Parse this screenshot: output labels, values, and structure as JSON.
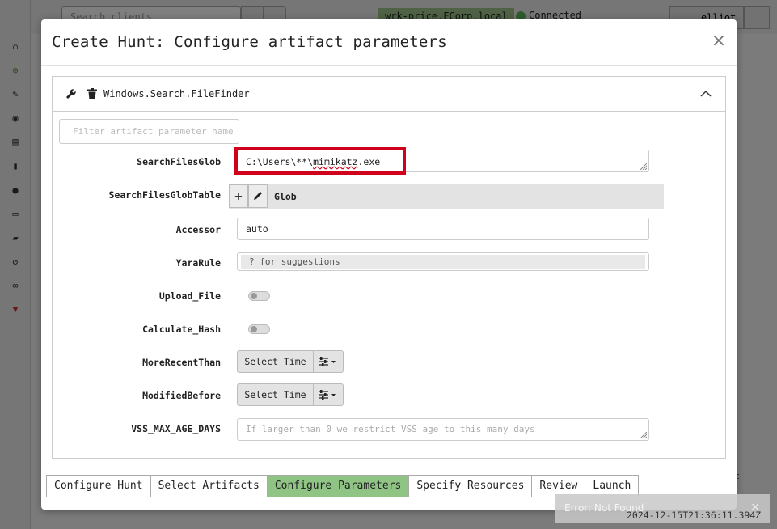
{
  "background": {
    "search_placeholder": "Search clients",
    "host": "wrk-price.FCorp.local",
    "connection_status": "Connected",
    "user": "elliot",
    "timestamp": "2024-12-15T21:36:11.394Z",
    "side_letter": "c"
  },
  "modal": {
    "title": "Create Hunt: Configure artifact parameters",
    "close_glyph": "×"
  },
  "artifact": {
    "name": "Windows.Search.FileFinder",
    "filter_placeholder": "Filter artifact parameter name"
  },
  "params": {
    "search_files_glob": {
      "label": "SearchFilesGlob",
      "value_prefix": "C:\\Users\\**\\",
      "value_word": "mimikatz",
      "value_suffix": ".exe"
    },
    "search_files_glob_table": {
      "label": "SearchFilesGlobTable",
      "column": "Glob"
    },
    "accessor": {
      "label": "Accessor",
      "value": "auto"
    },
    "yara_rule": {
      "label": "YaraRule",
      "placeholder": "? for suggestions"
    },
    "upload_file": {
      "label": "Upload_File",
      "enabled": false
    },
    "calculate_hash": {
      "label": "Calculate_Hash",
      "enabled": false
    },
    "more_recent_than": {
      "label": "MoreRecentThan",
      "button": "Select Time"
    },
    "modified_before": {
      "label": "ModifiedBefore",
      "button": "Select Time"
    },
    "vss_max_age_days": {
      "label": "VSS_MAX_AGE_DAYS",
      "placeholder": "If larger than 0 we restrict VSS age to this many days"
    }
  },
  "wizard": {
    "steps": [
      "Configure Hunt",
      "Select Artifacts",
      "Configure Parameters",
      "Specify Resources",
      "Review",
      "Launch"
    ],
    "active_index": 2
  },
  "toast": {
    "message": "Error: Not Found",
    "close_glyph": "×"
  },
  "colors": {
    "active_step": "#8fc485",
    "highlight": "#d0021b",
    "host_badge": "#9fc58b"
  }
}
